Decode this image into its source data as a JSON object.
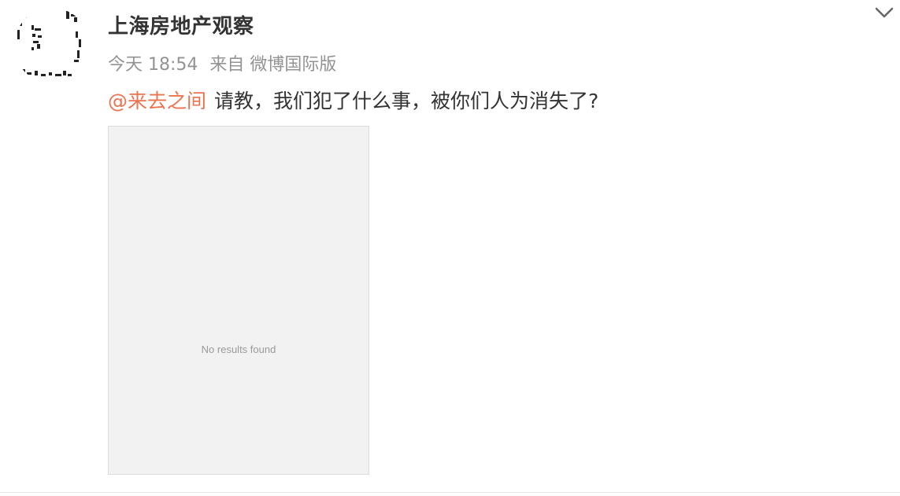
{
  "post": {
    "author_name": "上海房地产观察",
    "timestamp": "今天 18:54",
    "source": "来自 微博国际版",
    "mention": "@来去之间",
    "text": "请教，我们犯了什么事，被你们人为消失了?",
    "image_placeholder_text": "No results found"
  },
  "icons": {
    "menu": "chevron-down-icon",
    "avatar": "avatar-image"
  },
  "colors": {
    "mention": "#eb7350",
    "name": "#333333",
    "meta": "#939393",
    "placeholder_bg": "#f2f2f2"
  }
}
